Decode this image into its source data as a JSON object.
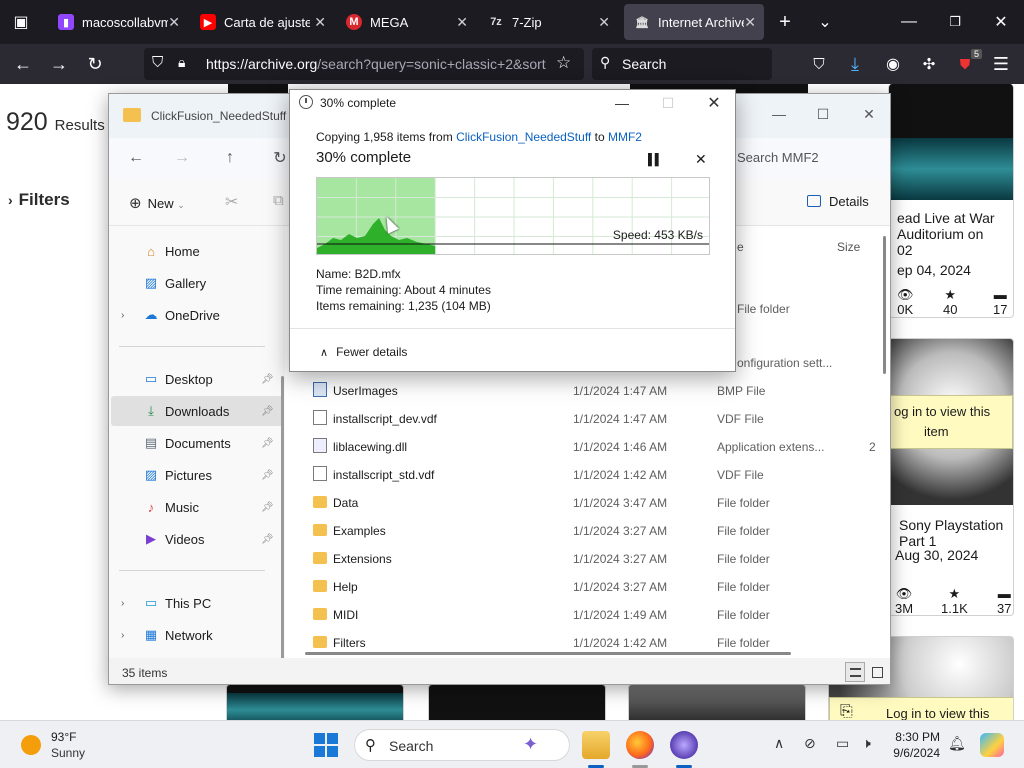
{
  "browser": {
    "tabs": [
      {
        "title": "macoscollabvm",
        "icon": "twitch-icon",
        "color": "#9146ff"
      },
      {
        "title": "Carta de ajuste",
        "icon": "youtube-icon",
        "color": "#ff0000"
      },
      {
        "title": "MEGA",
        "icon": "mega-icon",
        "color": "#d9272e"
      },
      {
        "title": "7-Zip",
        "icon": "7zip-icon",
        "color": "#dddddd"
      },
      {
        "title": "Internet Archive",
        "icon": "archive-icon",
        "color": "#dddddd"
      }
    ],
    "url_host": "https://archive.org",
    "url_path": "/search?query=sonic+classic+2&sort",
    "search_placeholder": "Search",
    "extension_badge": "5"
  },
  "page": {
    "results_count": "920",
    "results_label": "Results",
    "filters_label": "Filters",
    "cards": [
      {
        "title_line1": "ead Live at War",
        "title_line2": "Auditorium on",
        "title_line3": "02",
        "date": "ep 04, 2024",
        "views": "0K",
        "favs": "40",
        "reviews": "17"
      },
      {
        "login_text_line1": "og in to view this",
        "login_text_line2": "item"
      },
      {
        "title_line1": "Sony Playstation",
        "title_line2": "Part 1",
        "date": "Aug 30, 2024",
        "views": "3M",
        "favs": "1.1K",
        "reviews": "37"
      },
      {
        "login_text_line1": "Log in to view this"
      }
    ]
  },
  "explorer": {
    "title": "ClickFusion_NeededStuff",
    "search_placeholder": "Search MMF2",
    "new_label": "New",
    "details_label": "Details",
    "sidebar": [
      {
        "label": "Home",
        "icon": "home-icon"
      },
      {
        "label": "Gallery",
        "icon": "gallery-icon"
      },
      {
        "label": "OneDrive",
        "icon": "cloud-icon"
      },
      {
        "label": "Desktop",
        "icon": "desktop-icon"
      },
      {
        "label": "Downloads",
        "icon": "download-icon"
      },
      {
        "label": "Documents",
        "icon": "documents-icon"
      },
      {
        "label": "Pictures",
        "icon": "pictures-icon"
      },
      {
        "label": "Music",
        "icon": "music-icon"
      },
      {
        "label": "Videos",
        "icon": "videos-icon"
      },
      {
        "label": "This PC",
        "icon": "computer-icon"
      },
      {
        "label": "Network",
        "icon": "network-icon"
      }
    ],
    "columns": {
      "type": "e",
      "size": "Size"
    },
    "partial_rows": [
      {
        "type": "File folder"
      },
      {
        "type": "onfiguration sett..."
      }
    ],
    "files": [
      {
        "name": "UserImages",
        "date": "1/1/2024 1:47 AM",
        "type": "BMP File",
        "size": "",
        "kind": "bmp"
      },
      {
        "name": "installscript_dev.vdf",
        "date": "1/1/2024 1:47 AM",
        "type": "VDF File",
        "size": "",
        "kind": "doc"
      },
      {
        "name": "liblacewing.dll",
        "date": "1/1/2024 1:46 AM",
        "type": "Application extens...",
        "size": "2",
        "kind": "dll"
      },
      {
        "name": "installscript_std.vdf",
        "date": "1/1/2024 1:42 AM",
        "type": "VDF File",
        "size": "",
        "kind": "doc"
      },
      {
        "name": "Data",
        "date": "1/1/2024 3:47 AM",
        "type": "File folder",
        "size": "",
        "kind": "folder"
      },
      {
        "name": "Examples",
        "date": "1/1/2024 3:27 AM",
        "type": "File folder",
        "size": "",
        "kind": "folder"
      },
      {
        "name": "Extensions",
        "date": "1/1/2024 3:27 AM",
        "type": "File folder",
        "size": "",
        "kind": "folder"
      },
      {
        "name": "Help",
        "date": "1/1/2024 3:27 AM",
        "type": "File folder",
        "size": "",
        "kind": "folder"
      },
      {
        "name": "MIDI",
        "date": "1/1/2024 1:49 AM",
        "type": "File folder",
        "size": "",
        "kind": "folder"
      },
      {
        "name": "Filters",
        "date": "1/1/2024 1:42 AM",
        "type": "File folder",
        "size": "",
        "kind": "folder"
      }
    ],
    "status_count": "35 items"
  },
  "dialog": {
    "title": "30% complete",
    "copy_prefix": "Copying 1,958 items from",
    "source": "ClickFusion_NeededStuff",
    "to_word": "to",
    "dest": "MMF2",
    "heading": "30% complete",
    "progress": 0.3,
    "speed": "Speed: 453 KB/s",
    "name_line": "Name:  B2D.mfx",
    "time_line": "Time remaining:  About 4 minutes",
    "items_line": "Items remaining:  1,235 (104 MB)",
    "fewer_details": "Fewer details",
    "fill_color": "#a6e6a1",
    "area_color": "#2fb02a"
  },
  "taskbar": {
    "temp": "93°F",
    "condition": "Sunny",
    "search_placeholder": "Search",
    "time": "8:30 PM",
    "date": "9/6/2024"
  }
}
